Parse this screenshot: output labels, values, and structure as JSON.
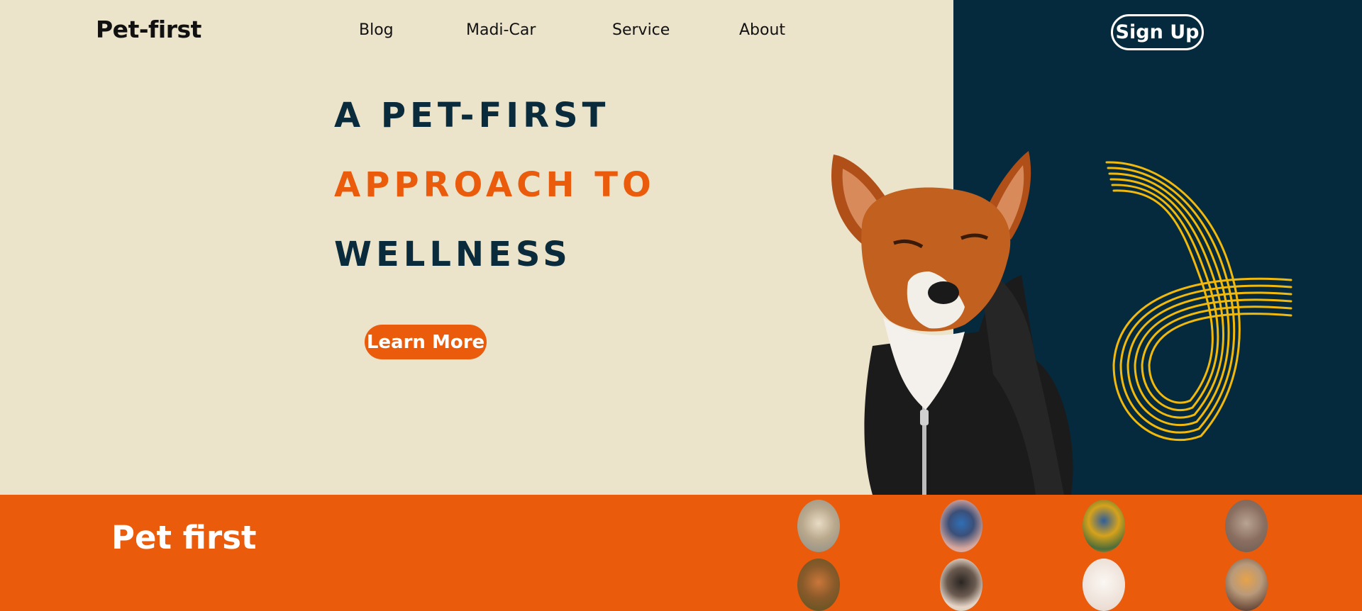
{
  "brand": {
    "logo": "Pet-first"
  },
  "nav": {
    "items": [
      "Blog",
      "Madi-Car",
      "Service",
      "About"
    ]
  },
  "header": {
    "signup_label": "Sign Up"
  },
  "hero": {
    "line1": "A PET-FIRST",
    "line2": "APPROACH TO",
    "line3": "WELLNESS",
    "cta_label": "Learn More"
  },
  "band": {
    "title": "Pet first"
  },
  "pets": [
    "cat",
    "bluebird",
    "macaw",
    "tabby-cat",
    "fox",
    "guinea-pig",
    "white-cat",
    "cockatiel"
  ],
  "colors": {
    "cream": "#ece3cb",
    "navy": "#062a3d",
    "orange": "#ea5b0c",
    "yellow": "#f2b90d"
  }
}
